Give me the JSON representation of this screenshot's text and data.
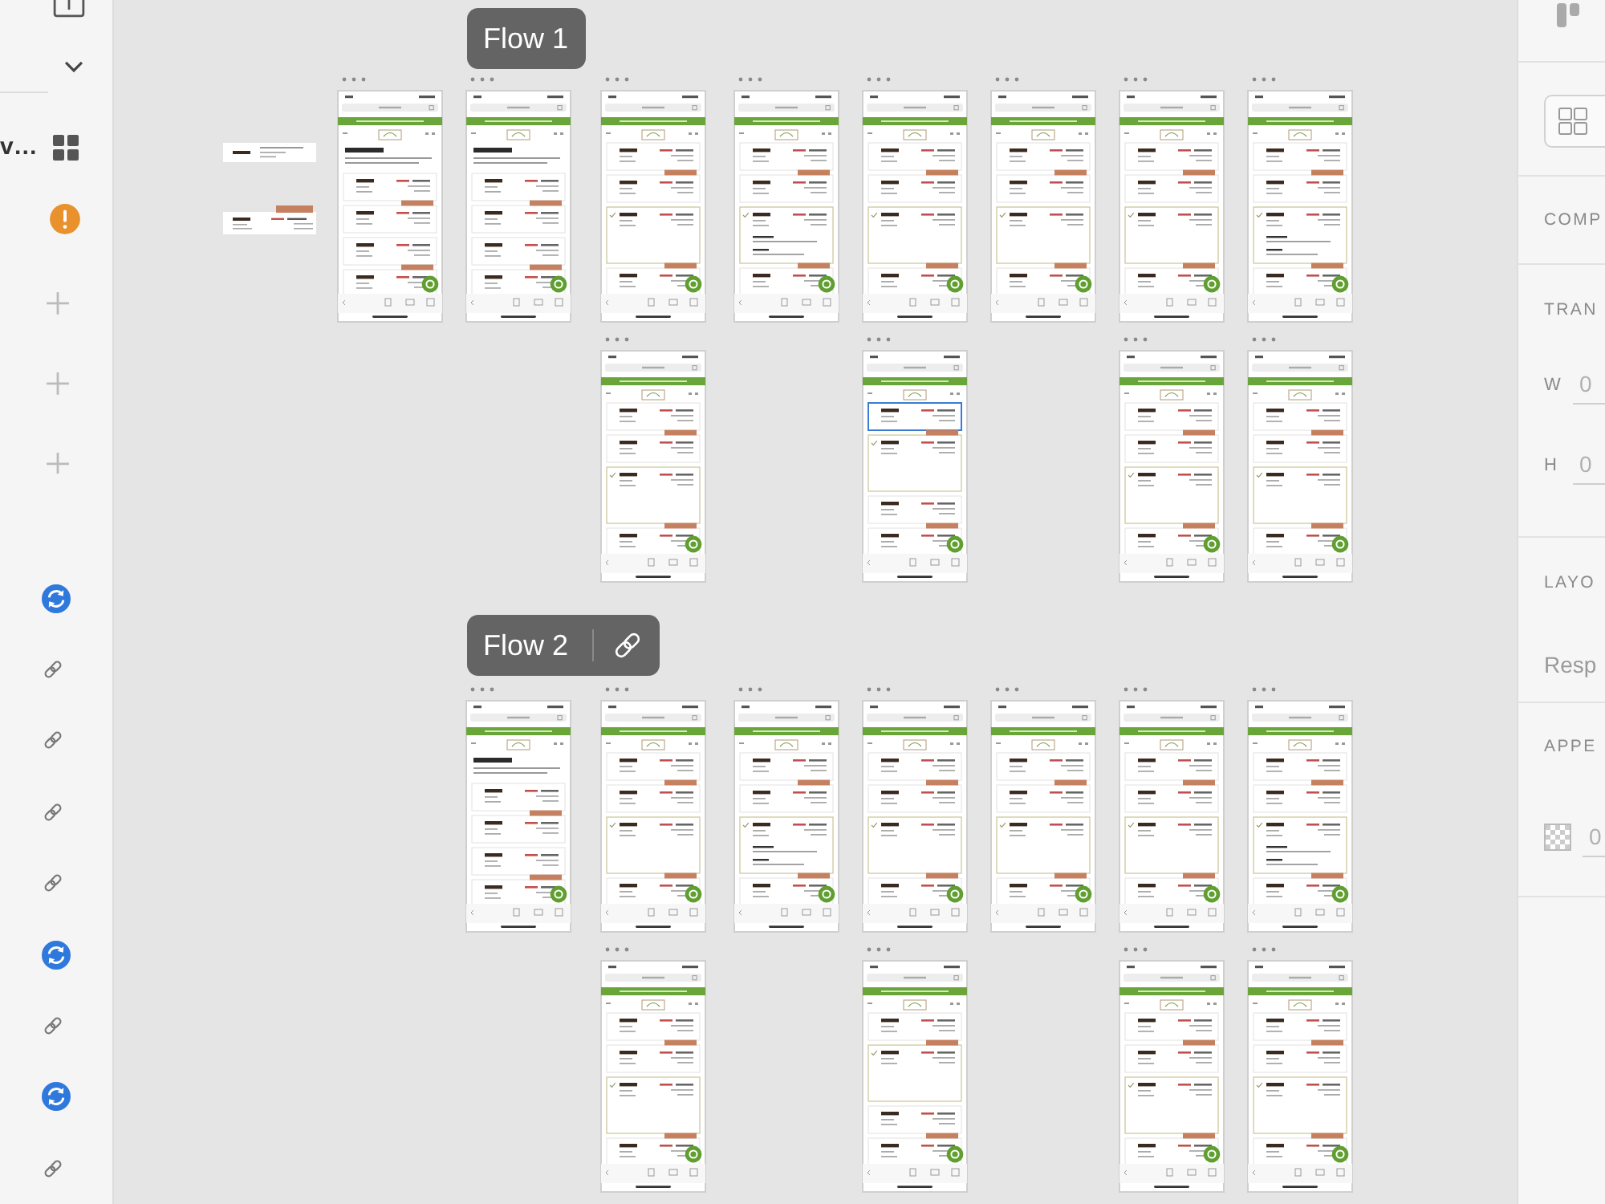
{
  "left_panel": {
    "label": "v…",
    "icons": [
      {
        "kind": "grid"
      },
      {
        "kind": "warning"
      },
      {
        "kind": "add"
      },
      {
        "kind": "add"
      },
      {
        "kind": "add"
      }
    ],
    "rows": [
      {
        "kind": "sync"
      },
      {
        "kind": "link"
      },
      {
        "kind": "link"
      },
      {
        "kind": "link"
      },
      {
        "kind": "link"
      },
      {
        "kind": "sync"
      },
      {
        "kind": "link"
      },
      {
        "kind": "sync"
      },
      {
        "kind": "link"
      }
    ]
  },
  "components": [
    {
      "kind": "plan"
    },
    {
      "kind": "offer"
    }
  ],
  "flows": [
    {
      "name": "Flow 1",
      "linked": false,
      "rows": [
        [
          {
            "kind": "intro",
            "expanded": [
              false,
              false,
              false,
              false
            ],
            "selected": false
          },
          {
            "kind": "intro",
            "expanded": [
              false,
              false,
              false,
              false
            ],
            "selected": false
          },
          {
            "kind": "list",
            "expanded": [
              false,
              false,
              true,
              false
            ],
            "detail": false,
            "selected": false
          },
          {
            "kind": "list",
            "expanded": [
              false,
              false,
              true,
              false
            ],
            "detail": true,
            "selected": false
          },
          {
            "kind": "list",
            "expanded": [
              false,
              false,
              true,
              false
            ],
            "detail": false,
            "selected": false
          },
          {
            "kind": "list",
            "expanded": [
              false,
              false,
              true,
              false
            ],
            "detail": false,
            "selected": false
          },
          {
            "kind": "list",
            "expanded": [
              false,
              false,
              true,
              false
            ],
            "detail": false,
            "selected": false
          },
          {
            "kind": "list",
            "expanded": [
              false,
              false,
              true,
              false
            ],
            "detail": true,
            "selected": false
          }
        ],
        [
          {
            "kind": "list",
            "expanded": [
              false,
              false,
              true,
              false
            ],
            "detail": false,
            "selected": false
          },
          {
            "kind": "list",
            "expanded": [
              false,
              true,
              false,
              false
            ],
            "detail": false,
            "selected": true
          },
          {
            "kind": "list",
            "expanded": [
              false,
              false,
              true,
              false
            ],
            "detail": false,
            "selected": false
          },
          {
            "kind": "list",
            "expanded": [
              false,
              false,
              true,
              false
            ],
            "detail": false,
            "selected": false
          }
        ]
      ]
    },
    {
      "name": "Flow 2",
      "linked": true,
      "rows": [
        [
          {
            "kind": "intro",
            "expanded": [
              false,
              false,
              false,
              false
            ],
            "selected": false
          },
          {
            "kind": "list",
            "expanded": [
              false,
              false,
              true,
              false
            ],
            "detail": false,
            "selected": false
          },
          {
            "kind": "list",
            "expanded": [
              false,
              false,
              true,
              false
            ],
            "detail": true,
            "selected": false
          },
          {
            "kind": "list",
            "expanded": [
              false,
              false,
              true,
              false
            ],
            "detail": false,
            "selected": false
          },
          {
            "kind": "list",
            "expanded": [
              false,
              false,
              true,
              false
            ],
            "detail": false,
            "selected": false
          },
          {
            "kind": "list",
            "expanded": [
              false,
              false,
              true,
              false
            ],
            "detail": false,
            "selected": false
          },
          {
            "kind": "list",
            "expanded": [
              false,
              false,
              true,
              false
            ],
            "detail": true,
            "selected": false
          }
        ],
        [
          {
            "kind": "list",
            "expanded": [
              false,
              false,
              true,
              false
            ],
            "detail": false,
            "selected": false
          },
          {
            "kind": "list",
            "expanded": [
              false,
              true,
              false,
              false
            ],
            "detail": false,
            "selected": false
          },
          {
            "kind": "list",
            "expanded": [
              false,
              false,
              true,
              false
            ],
            "detail": false,
            "selected": false
          },
          {
            "kind": "list",
            "expanded": [
              false,
              false,
              true,
              false
            ],
            "detail": false,
            "selected": false
          }
        ]
      ]
    }
  ],
  "right_panel": {
    "component": {
      "heading": "COMP"
    },
    "transform": {
      "heading": "TRAN",
      "width": {
        "label": "W",
        "value": "0"
      },
      "height": {
        "label": "H",
        "value": "0"
      }
    },
    "layout": {
      "heading": "LAYO",
      "option": "Resp"
    },
    "appearance": {
      "heading": "APPE",
      "opacity": {
        "value": "0"
      }
    }
  }
}
